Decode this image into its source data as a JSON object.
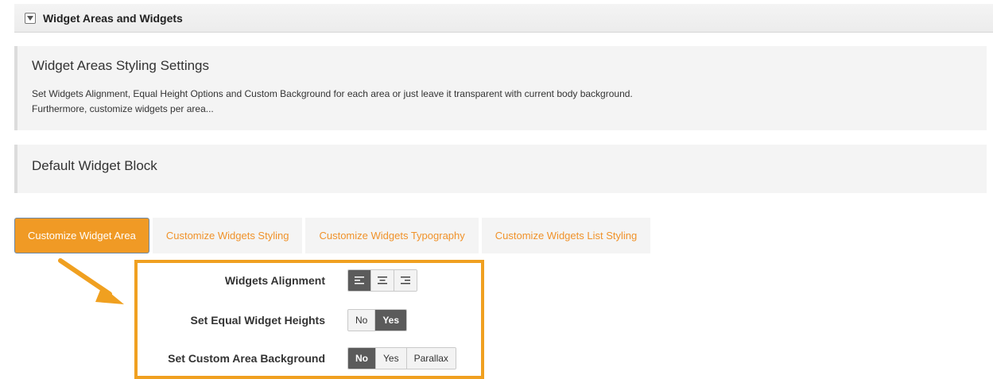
{
  "section": {
    "title": "Widget Areas and Widgets",
    "toggle_icon": "collapse-triangle-icon"
  },
  "panels": [
    {
      "title": "Widget Areas Styling Settings",
      "description_lines": [
        "Set Widgets Alignment, Equal Height Options and Custom Background for each area or just leave it transparent with current body background.",
        "Furthermore, customize widgets per area..."
      ]
    },
    {
      "title": "Default Widget Block"
    }
  ],
  "tabs": [
    {
      "label": "Customize Widget Area",
      "active": true
    },
    {
      "label": "Customize Widgets Styling",
      "active": false
    },
    {
      "label": "Customize Widgets Typography",
      "active": false
    },
    {
      "label": "Customize Widgets List Styling",
      "active": false
    }
  ],
  "settings": {
    "alignment": {
      "label": "Widgets Alignment",
      "options": [
        {
          "icon": "align-left-icon",
          "selected": true
        },
        {
          "icon": "align-center-icon",
          "selected": false
        },
        {
          "icon": "align-right-icon",
          "selected": false
        }
      ]
    },
    "equal_heights": {
      "label": "Set Equal Widget Heights",
      "options": [
        {
          "label": "No",
          "selected": false
        },
        {
          "label": "Yes",
          "selected": true
        }
      ]
    },
    "custom_background": {
      "label": "Set Custom Area Background",
      "options": [
        {
          "label": "No",
          "selected": true
        },
        {
          "label": "Yes",
          "selected": false
        },
        {
          "label": "Parallax",
          "selected": false
        }
      ]
    }
  },
  "colors": {
    "accent": "#f09a25",
    "highlight_border": "#f0a020",
    "selected_segment": "#5b5b5b",
    "tab_text": "#f0922a"
  }
}
